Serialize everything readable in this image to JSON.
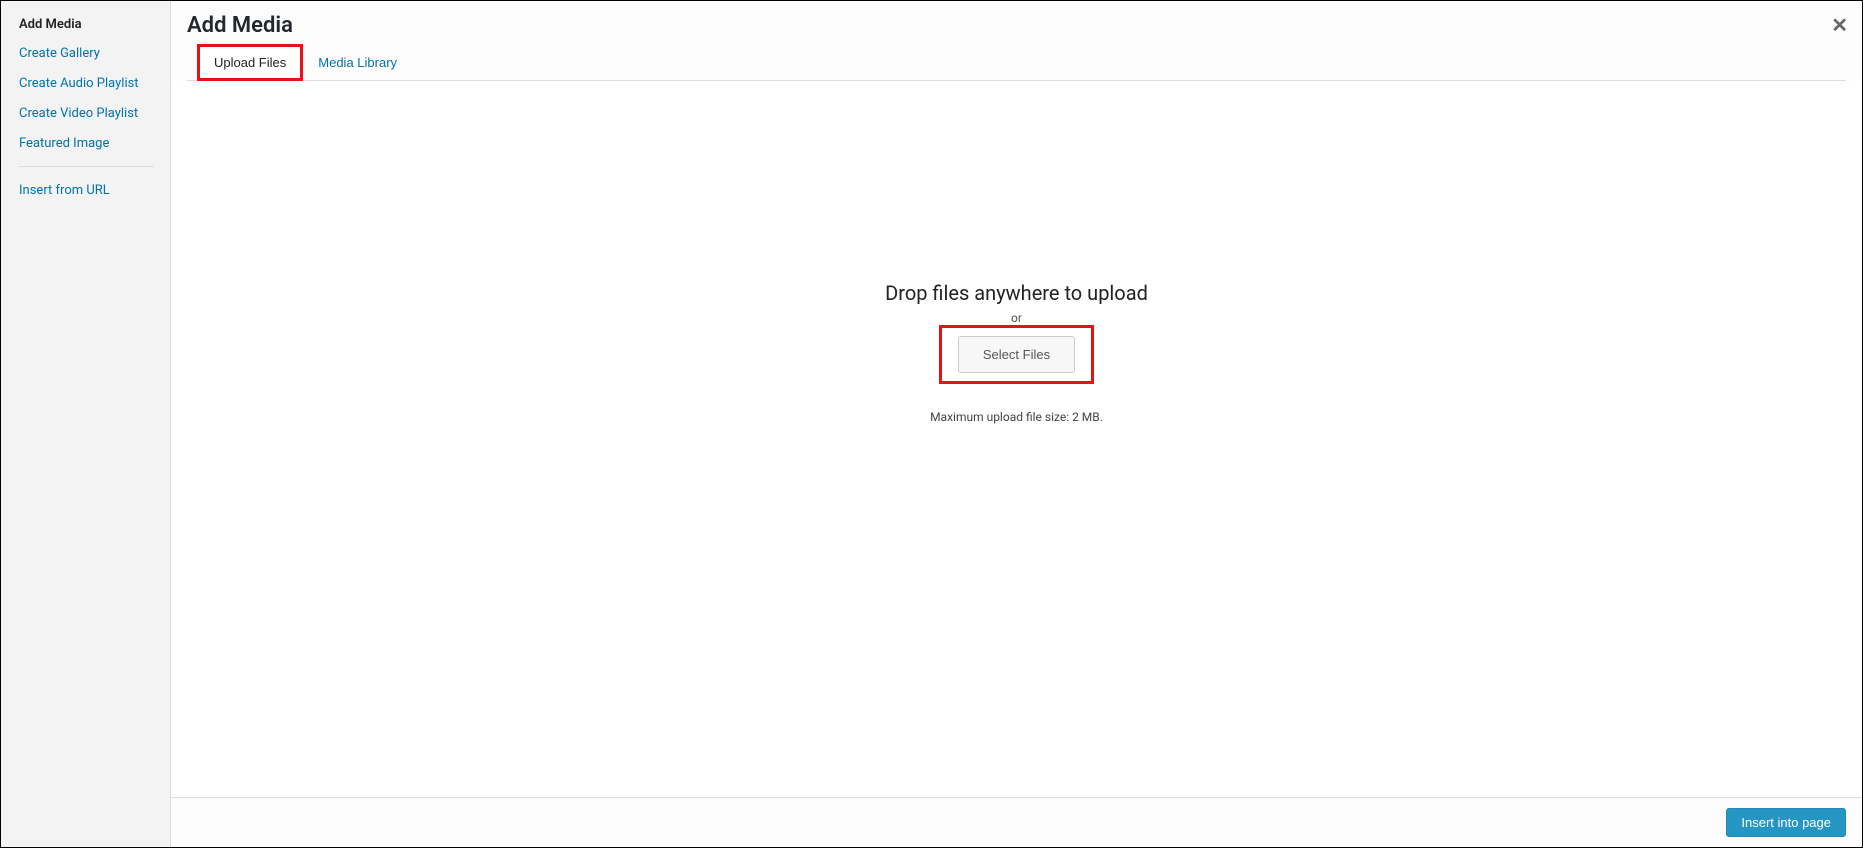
{
  "sidebar": {
    "title": "Add Media",
    "links": [
      {
        "label": "Create Gallery"
      },
      {
        "label": "Create Audio Playlist"
      },
      {
        "label": "Create Video Playlist"
      },
      {
        "label": "Featured Image"
      }
    ],
    "insert_from_url": "Insert from URL"
  },
  "header": {
    "title": "Add Media"
  },
  "tabs": {
    "upload_files": "Upload Files",
    "media_library": "Media Library"
  },
  "upload": {
    "drop_text": "Drop files anywhere to upload",
    "or": "or",
    "select_files": "Select Files",
    "max_size": "Maximum upload file size: 2 MB."
  },
  "footer": {
    "insert_into_page": "Insert into page"
  },
  "close_icon": "✕"
}
